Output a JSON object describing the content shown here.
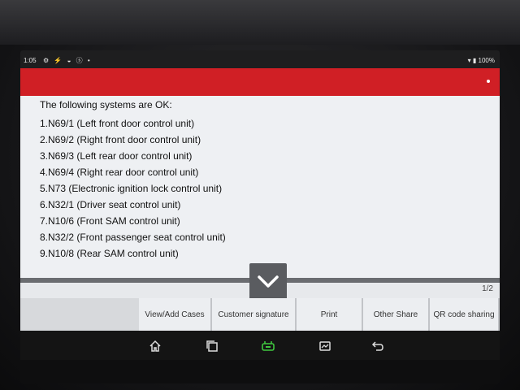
{
  "statusbar": {
    "time": "1:05",
    "icons": "⚙ ⚡ ◒ ⓢ •",
    "battery": "▾ ▮ 100%"
  },
  "report": {
    "heading": "The following systems are OK:",
    "items": [
      "1.N69/1 (Left front door control unit)",
      "2.N69/2 (Right front door control unit)",
      "3.N69/3 (Left rear door control unit)",
      "4.N69/4 (Right rear door control unit)",
      "5.N73 (Electronic ignition lock control unit)",
      "6.N32/1 (Driver seat control unit)",
      "7.N10/6 (Front SAM control unit)",
      "8.N32/2 (Front passenger seat control unit)",
      "9.N10/8 (Rear SAM control unit)"
    ]
  },
  "pagination": {
    "label": "1/2"
  },
  "actions": {
    "view_add_cases": "View/Add Cases",
    "customer_signature": "Customer signature",
    "print": "Print",
    "other_share": "Other Share",
    "qr_code_sharing": "QR code sharing"
  },
  "icons": {
    "scroll_down": "chevron-down-icon",
    "home": "home-icon",
    "recents": "recents-icon",
    "vci": "vci-icon",
    "screenshot": "screenshot-icon",
    "back": "back-icon"
  },
  "colors": {
    "brand_red": "#d01f25",
    "vci_green": "#3ec63e"
  }
}
